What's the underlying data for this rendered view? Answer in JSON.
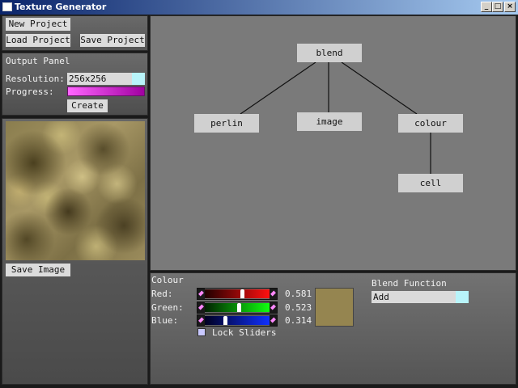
{
  "window": {
    "title": "Texture Generator",
    "minimize": "_",
    "maximize": "□",
    "close": "×"
  },
  "toolbar": {
    "new_project": "New Project",
    "load_project": "Load Project",
    "save_project": "Save Project"
  },
  "output_panel": {
    "title": "Output Panel",
    "resolution_label": "Resolution:",
    "resolution_value": "256x256",
    "progress_label": "Progress:",
    "progress": 1.0,
    "create_button": "Create"
  },
  "image_panel": {
    "save_button": "Save Image"
  },
  "graph": {
    "nodes": {
      "blend": "blend",
      "perlin": "perlin",
      "image": "image",
      "colour": "colour",
      "cell": "cell"
    }
  },
  "colour_panel": {
    "title": "Colour",
    "red_label": "Red:",
    "green_label": "Green:",
    "blue_label": "Blue:",
    "red": 0.581,
    "green": 0.523,
    "blue": 0.314,
    "red_text": "0.581",
    "green_text": "0.523",
    "blue_text": "0.314",
    "swatch_color": "#958550",
    "lock_label": "Lock Sliders",
    "lock_checked": false
  },
  "blend_panel": {
    "title": "Blend Function",
    "value": "Add"
  },
  "icons": {
    "slider_arrow": "diamond-arrow-icon",
    "window_icon": "app-window-icon"
  }
}
